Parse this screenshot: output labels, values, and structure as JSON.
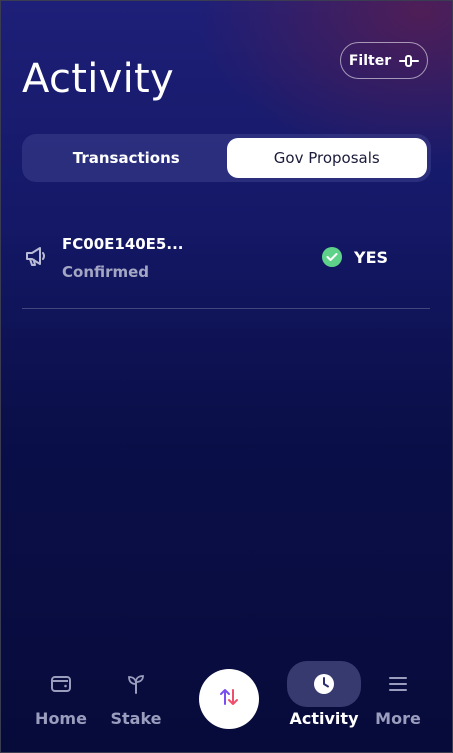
{
  "header": {
    "title": "Activity",
    "filter_label": "Filter"
  },
  "tabs": [
    {
      "label": "Transactions",
      "active": false
    },
    {
      "label": "Gov Proposals",
      "active": true
    }
  ],
  "activity": [
    {
      "icon": "megaphone-icon",
      "id": "FC00E140E5...",
      "status": "Confirmed",
      "vote": "YES",
      "vote_icon": "check-circle-icon"
    }
  ],
  "nav": {
    "home": {
      "label": "Home",
      "icon": "wallet-icon"
    },
    "stake": {
      "label": "Stake",
      "icon": "sprout-icon"
    },
    "swap": {
      "icon": "swap-arrows-icon"
    },
    "activity": {
      "label": "Activity",
      "icon": "clock-icon",
      "active": true
    },
    "more": {
      "label": "More",
      "icon": "menu-icon"
    }
  },
  "colors": {
    "background_top": "#1e1f78",
    "background_bottom": "#070b3a",
    "confirmed_check": "#5fd28a",
    "inactive_nav": "#9a9dbd"
  }
}
